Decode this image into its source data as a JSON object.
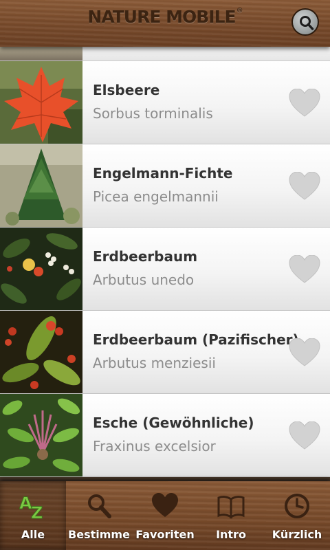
{
  "header": {
    "logo": "NATURE MOBILE",
    "search_icon": "search-icon"
  },
  "species": [
    {
      "name": "Elsbeere",
      "scientific": "Sorbus torminalis",
      "thumbnail": "red-maple-leaf",
      "favorite": false
    },
    {
      "name": "Engelmann-Fichte",
      "scientific": "Picea engelmannii",
      "thumbnail": "spruce-tree",
      "favorite": false
    },
    {
      "name": "Erdbeerbaum",
      "scientific": "Arbutus unedo",
      "thumbnail": "strawberry-tree-fruits",
      "favorite": false
    },
    {
      "name": "Erdbeerbaum (Pazifischer)",
      "scientific": "Arbutus menziesii",
      "thumbnail": "pacific-madrone-berries",
      "favorite": false
    },
    {
      "name": "Esche (Gewöhnliche)",
      "scientific": "Fraxinus excelsior",
      "thumbnail": "ash-leaves",
      "favorite": false
    }
  ],
  "nav": {
    "tabs": [
      {
        "label": "Alle",
        "icon": "az-icon",
        "active": true
      },
      {
        "label": "Bestimme",
        "icon": "magnifier-icon",
        "active": false
      },
      {
        "label": "Favoriten",
        "icon": "heart-icon",
        "active": false
      },
      {
        "label": "Intro",
        "icon": "book-icon",
        "active": false
      },
      {
        "label": "Kürzlich",
        "icon": "clock-icon",
        "active": false
      }
    ]
  },
  "colors": {
    "wood": "#7a4c2c",
    "text_primary": "#333333",
    "text_secondary": "#8c8c8c",
    "heart_inactive": "#cfcfcf",
    "az_green": "#7ac943"
  }
}
